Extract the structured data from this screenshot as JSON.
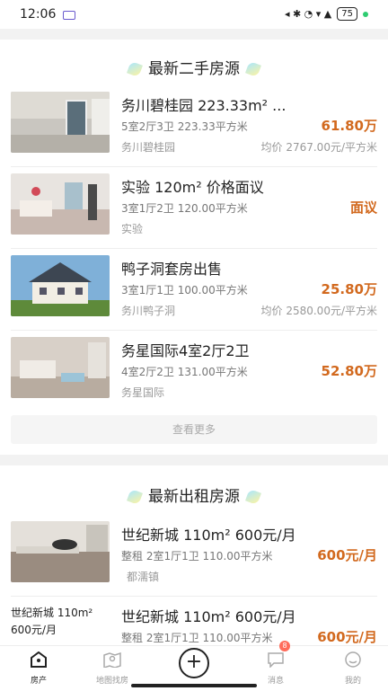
{
  "status_bar": {
    "time": "12:06",
    "icons_text": "◂ ✱ ◔ ▾ ▲",
    "battery": "75"
  },
  "sections": {
    "second_hand": {
      "title": "最新二手房源",
      "more_label": "查看更多"
    },
    "rental": {
      "title": "最新出租房源"
    }
  },
  "listings": [
    {
      "title": "务川碧桂园 223.33m² ...",
      "sub": "5室2厅3卫  223.33平方米",
      "price": "61.80万",
      "area": "务川碧桂园",
      "unit_price": "均价 2767.00元/平方米"
    },
    {
      "title": "实验 120m² 价格面议",
      "sub": "3室1厅2卫  120.00平方米",
      "price": "面议",
      "area": "实验",
      "unit_price": ""
    },
    {
      "title": "鸭子洞套房出售",
      "sub": "3室1厅1卫  100.00平方米",
      "price": "25.80万",
      "area": "务川鸭子洞",
      "unit_price": "均价 2580.00元/平方米"
    },
    {
      "title": "务星国际4室2厅2卫",
      "sub": "4室2厅2卫  131.00平方米",
      "price": "52.80万",
      "area": "务星国际",
      "unit_price": ""
    }
  ],
  "rentals": [
    {
      "title": "世纪新城 110m² 600元/月",
      "sub": "整租  2室1厅1卫  110.00平方米",
      "price": "600元/月",
      "area": "都濡镇",
      "alt": ""
    },
    {
      "title": "世纪新城 110m² 600元/月",
      "sub": "整租  2室1厅1卫  110.00平方米",
      "price": "600元/月",
      "area": "",
      "alt": "世纪新城 110m² 600元/月"
    }
  ],
  "tabbar": {
    "home": "房产",
    "map": "地图找房",
    "add": "+",
    "messages": "消息",
    "mine": "我的",
    "badge": "8"
  }
}
